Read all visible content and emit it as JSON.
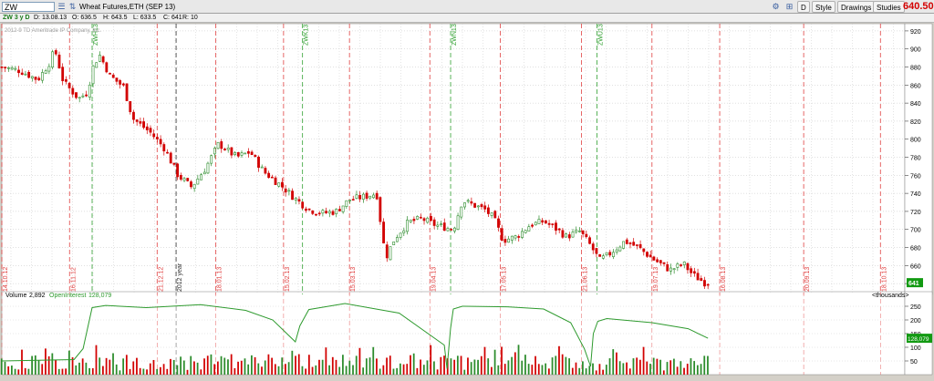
{
  "toolbar": {
    "symbol": "ZW",
    "description": "Wheat Futures,ETH (SEP 13)",
    "d_button": "D",
    "style_button": "Style",
    "drawings_button": "Drawings",
    "studies_button": "Studies",
    "last_price": "640.50"
  },
  "ohlc": {
    "period": "ZW 3 y D",
    "date": "D: 13.08.13",
    "open": "O: 636.5",
    "high": "H: 643.5",
    "low": "L: 633.5",
    "close": "C: 641",
    "range": "R: 10"
  },
  "watermark": "2012-9 TD Ameritrade IP Company, Inc.",
  "chart_data": [
    {
      "type": "candlestick",
      "ylim": [
        628,
        928
      ],
      "yticks": [
        640,
        660,
        680,
        700,
        720,
        740,
        760,
        780,
        800,
        820,
        840,
        860,
        880,
        900,
        920
      ],
      "grid": true,
      "price_label": "641",
      "date_markers": [
        {
          "x": 0.0,
          "label": "14.10.12",
          "style": "red"
        },
        {
          "x": 0.075,
          "label": "16.11.12",
          "style": "red"
        },
        {
          "x": 0.172,
          "label": "21.12.12",
          "style": "red"
        },
        {
          "x": 0.193,
          "label": "2012 year",
          "style": "black"
        },
        {
          "x": 0.237,
          "label": "18.01.13",
          "style": "red"
        },
        {
          "x": 0.312,
          "label": "15.02.13",
          "style": "red"
        },
        {
          "x": 0.385,
          "label": "15.03.13",
          "style": "red"
        },
        {
          "x": 0.474,
          "label": "19.04.13",
          "style": "red"
        },
        {
          "x": 0.552,
          "label": "17.05.13",
          "style": "red"
        },
        {
          "x": 0.642,
          "label": "21.06.13",
          "style": "red"
        },
        {
          "x": 0.72,
          "label": "19.07.13",
          "style": "red"
        },
        {
          "x": 0.795,
          "label": "16.08.13",
          "style": "red"
        },
        {
          "x": 0.888,
          "label": "20.09.13",
          "style": "red"
        },
        {
          "x": 0.973,
          "label": "18.10.13",
          "style": "red"
        }
      ],
      "expiry_markers": [
        {
          "x": 0.1,
          "label": "ZWH13"
        },
        {
          "x": 0.333,
          "label": "ZWK13"
        },
        {
          "x": 0.497,
          "label": "ZWN13"
        },
        {
          "x": 0.659,
          "label": "ZWU13"
        }
      ],
      "close_path": [
        [
          0.0,
          880
        ],
        [
          0.02,
          876
        ],
        [
          0.04,
          866
        ],
        [
          0.055,
          888
        ],
        [
          0.058,
          902
        ],
        [
          0.068,
          864
        ],
        [
          0.085,
          845
        ],
        [
          0.095,
          852
        ],
        [
          0.1,
          878
        ],
        [
          0.108,
          894
        ],
        [
          0.12,
          870
        ],
        [
          0.135,
          858
        ],
        [
          0.145,
          823
        ],
        [
          0.165,
          807
        ],
        [
          0.18,
          790
        ],
        [
          0.195,
          760
        ],
        [
          0.21,
          747
        ],
        [
          0.225,
          767
        ],
        [
          0.24,
          795
        ],
        [
          0.26,
          780
        ],
        [
          0.275,
          786
        ],
        [
          0.29,
          764
        ],
        [
          0.31,
          748
        ],
        [
          0.325,
          734
        ],
        [
          0.34,
          722
        ],
        [
          0.355,
          718
        ],
        [
          0.37,
          720
        ],
        [
          0.385,
          733
        ],
        [
          0.4,
          736
        ],
        [
          0.415,
          740
        ],
        [
          0.425,
          668
        ],
        [
          0.435,
          690
        ],
        [
          0.45,
          708
        ],
        [
          0.465,
          712
        ],
        [
          0.48,
          705
        ],
        [
          0.5,
          700
        ],
        [
          0.51,
          732
        ],
        [
          0.52,
          728
        ],
        [
          0.535,
          722
        ],
        [
          0.545,
          712
        ],
        [
          0.555,
          688
        ],
        [
          0.57,
          692
        ],
        [
          0.585,
          705
        ],
        [
          0.6,
          709
        ],
        [
          0.615,
          700
        ],
        [
          0.625,
          692
        ],
        [
          0.64,
          698
        ],
        [
          0.65,
          685
        ],
        [
          0.662,
          666
        ],
        [
          0.672,
          672
        ],
        [
          0.69,
          687
        ],
        [
          0.705,
          680
        ],
        [
          0.72,
          668
        ],
        [
          0.74,
          655
        ],
        [
          0.755,
          662
        ],
        [
          0.765,
          650
        ],
        [
          0.78,
          640
        ],
        [
          0.782,
          641
        ]
      ]
    },
    {
      "type": "bar",
      "title": "Volume",
      "volume_value": "2,892",
      "oi_label": "OpenInterest",
      "oi_value": "128,079",
      "unit_label": "<thousands>",
      "ylim": [
        0,
        280
      ],
      "yticks": [
        50,
        100,
        150,
        200,
        250
      ],
      "oi_series": [
        [
          0.0,
          50
        ],
        [
          0.08,
          55
        ],
        [
          0.09,
          95
        ],
        [
          0.1,
          245
        ],
        [
          0.115,
          253
        ],
        [
          0.16,
          245
        ],
        [
          0.22,
          256
        ],
        [
          0.27,
          235
        ],
        [
          0.3,
          200
        ],
        [
          0.325,
          120
        ],
        [
          0.33,
          178
        ],
        [
          0.34,
          238
        ],
        [
          0.38,
          260
        ],
        [
          0.44,
          225
        ],
        [
          0.49,
          108
        ],
        [
          0.493,
          22
        ],
        [
          0.497,
          170
        ],
        [
          0.5,
          240
        ],
        [
          0.51,
          250
        ],
        [
          0.56,
          248
        ],
        [
          0.6,
          240
        ],
        [
          0.63,
          190
        ],
        [
          0.645,
          95
        ],
        [
          0.652,
          30
        ],
        [
          0.655,
          150
        ],
        [
          0.66,
          195
        ],
        [
          0.67,
          205
        ],
        [
          0.72,
          190
        ],
        [
          0.76,
          168
        ],
        [
          0.782,
          133
        ]
      ]
    }
  ],
  "colors": {
    "background": "#ffffff",
    "up": "#2c8c2c",
    "down": "#d20000",
    "date_marker": "#e04040",
    "expiry_marker": "#30a030",
    "oi_line": "#2e9a2e",
    "price_badge": "#129a12"
  }
}
